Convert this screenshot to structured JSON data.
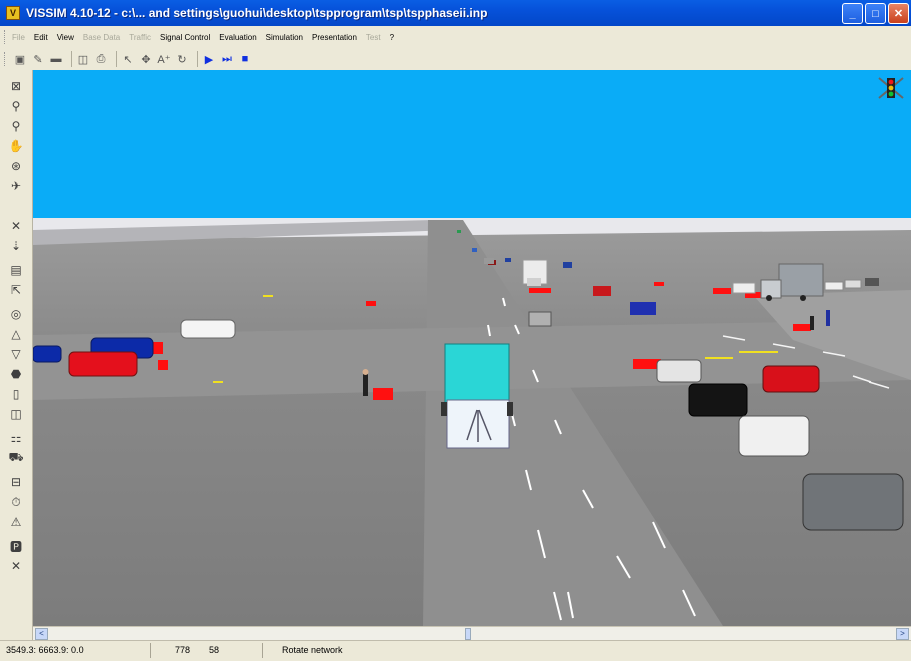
{
  "window": {
    "title": "VISSIM 4.10-12 - c:\\... and settings\\guohui\\desktop\\tspprogram\\tsp\\tspphaseii.inp",
    "app_icon": "V",
    "minimize_label": "_",
    "maximize_label": "□",
    "close_label": "✕"
  },
  "menu": [
    {
      "label": "File",
      "enabled": false
    },
    {
      "label": "Edit",
      "enabled": true
    },
    {
      "label": "View",
      "enabled": true
    },
    {
      "label": "Base Data",
      "enabled": false
    },
    {
      "label": "Traffic",
      "enabled": false
    },
    {
      "label": "Signal Control",
      "enabled": true
    },
    {
      "label": "Evaluation",
      "enabled": true
    },
    {
      "label": "Simulation",
      "enabled": true
    },
    {
      "label": "Presentation",
      "enabled": true
    },
    {
      "label": "Test",
      "enabled": false
    },
    {
      "label": "?",
      "enabled": true
    }
  ],
  "toolbar_icons": [
    "new-network-icon",
    "open-icon",
    "save-icon",
    "print-preview-icon",
    "print-icon",
    "select-icon",
    "multiselect-icon",
    "text-icon",
    "rotate-icon",
    "run-simulation-icon",
    "single-step-icon",
    "stop-icon"
  ],
  "left_tools": [
    "zoom-network-icon",
    "zoom-in-icon",
    "zoom-out-icon",
    "pan-hand-icon",
    "rotate-3d-icon",
    "fly-icon",
    "link-tool-icon",
    "connector-icon",
    "vehicle-input-icon",
    "routing-icon",
    "speed-limit-icon",
    "priority-rule-icon",
    "stop-sign-icon",
    "signal-head-icon",
    "detector-icon",
    "transit-stop-icon",
    "transit-line-icon",
    "node-icon",
    "queue-counter-icon",
    "travel-time-icon",
    "parking-icon",
    "pedestrian-icon"
  ],
  "scroll": {
    "left_arrow": "<",
    "right_arrow": ">"
  },
  "status": {
    "coordinates": "3549.3: 6663.9: 0.0",
    "value_a": "778",
    "value_b": "58",
    "mode": "Rotate network"
  },
  "colors": {
    "sky": "#0aacf7",
    "title_bar": "#0651d9",
    "bus": "#2ad6d6",
    "signal_red": "#ff1010"
  }
}
